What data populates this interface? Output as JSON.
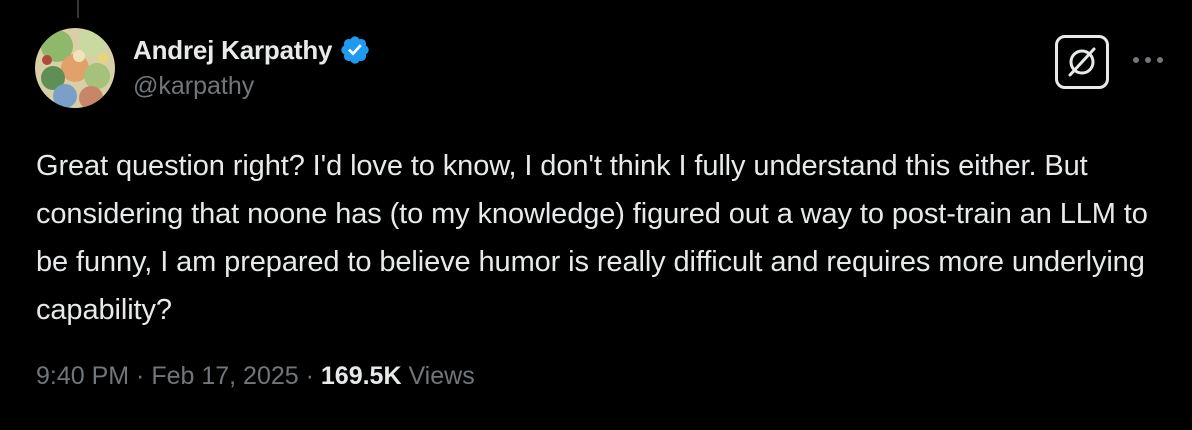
{
  "author": {
    "display_name": "Andrej Karpathy",
    "handle": "@karpathy",
    "verified": true
  },
  "icons": {
    "verified": "verified-badge-icon",
    "grok": "grok-icon",
    "more": "more-options-icon"
  },
  "colors": {
    "background": "#000000",
    "text_primary": "#e7e9ea",
    "text_secondary": "#71767b",
    "verified_blue": "#1d9bf0"
  },
  "tweet": {
    "text": "Great question right? I'd love to know, I don't think I fully understand this either. But considering that noone has (to my knowledge) figured out a way to post-train an LLM to be funny, I am prepared to believe humor is really difficult and requires more underlying capability?"
  },
  "meta": {
    "time": "9:40 PM",
    "separator_1": " · ",
    "date": "Feb 17, 2025",
    "separator_2": " · ",
    "views_count": "169.5K",
    "views_label": " Views"
  }
}
